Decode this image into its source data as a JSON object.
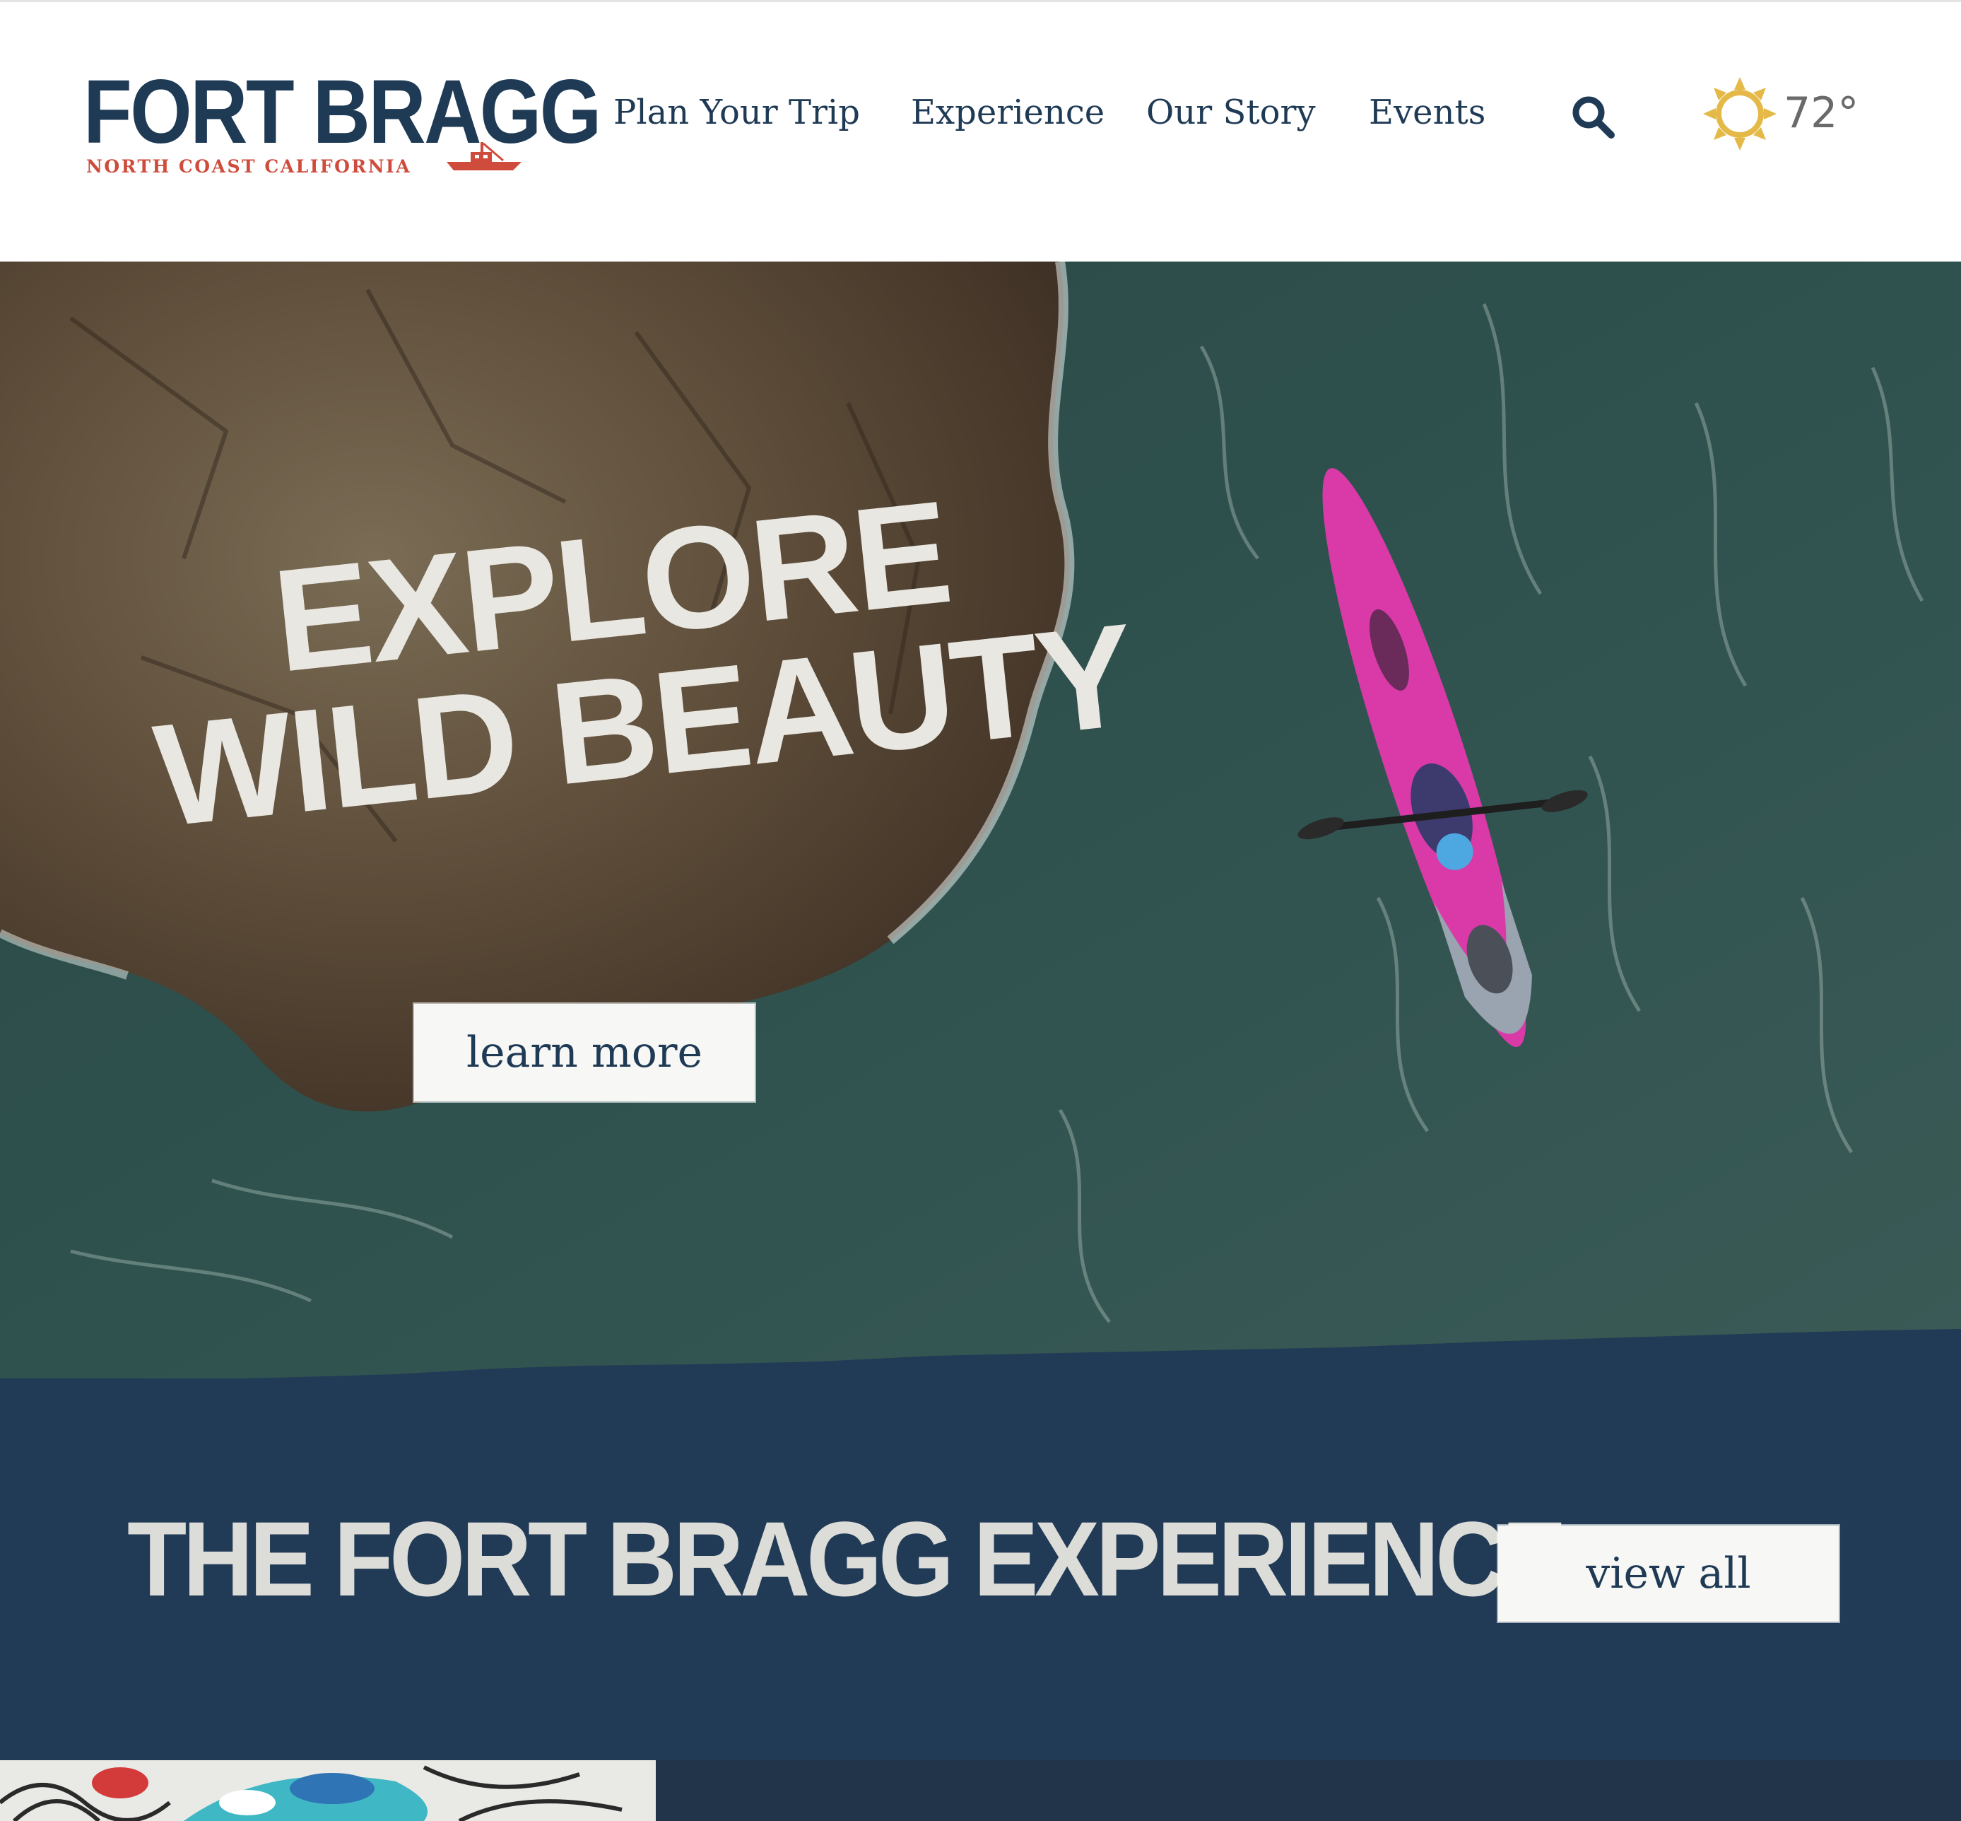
{
  "brand": {
    "name": "FORT BRAGG",
    "tagline": "NORTH COAST CALIFORNIA",
    "primary_color": "#1f3a55",
    "accent_color": "#cf4b3b"
  },
  "nav": {
    "items": [
      {
        "label": "Plan Your Trip"
      },
      {
        "label": "Experience"
      },
      {
        "label": "Our Story"
      },
      {
        "label": "Events"
      }
    ],
    "search_icon": "search-icon"
  },
  "weather": {
    "icon": "sun-icon",
    "temperature": "72°"
  },
  "hero": {
    "title_line1": "Explore",
    "title_line2": "Wild Beauty",
    "cta_label": "learn more"
  },
  "experience": {
    "title": "The Fort Bragg Experience",
    "cta_label": "view all",
    "band_color": "#213a55"
  }
}
